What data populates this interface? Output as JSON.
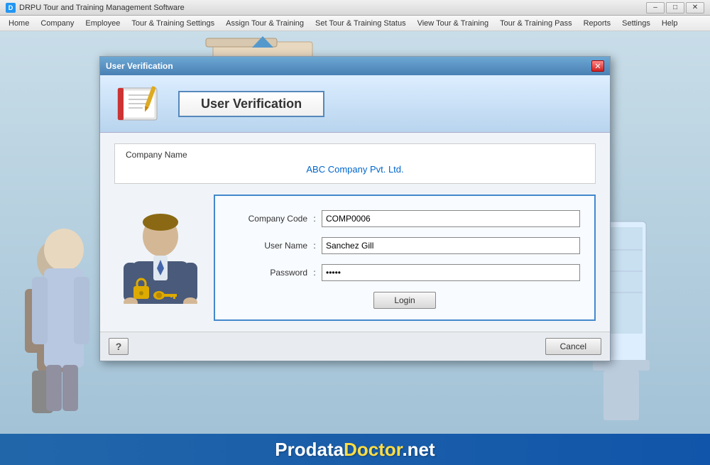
{
  "titlebar": {
    "icon": "D",
    "title": "DRPU Tour and Training Management Software",
    "minimize": "–",
    "maximize": "□",
    "close": "✕"
  },
  "menubar": {
    "items": [
      "Home",
      "Company",
      "Employee",
      "Tour & Training Settings",
      "Assign Tour & Training",
      "Set Tour & Training Status",
      "View Tour & Training",
      "Tour & Training Pass",
      "Reports",
      "Settings",
      "Help"
    ]
  },
  "dialog": {
    "title": "User Verification",
    "verification_heading": "User Verification",
    "company_label": "Company Name",
    "company_name": "ABC Company Pvt. Ltd.",
    "fields": {
      "company_code_label": "Company Code",
      "company_code_value": "COMP0006",
      "username_label": "User Name",
      "username_value": "Sanchez Gill",
      "password_label": "Password",
      "password_value": "•••••",
      "colon": ":"
    },
    "login_btn": "Login",
    "cancel_btn": "Cancel",
    "help_btn": "?"
  },
  "banner": {
    "text_plain": "Prodata",
    "text_highlight": "Doctor",
    "text_suffix": ".net"
  }
}
